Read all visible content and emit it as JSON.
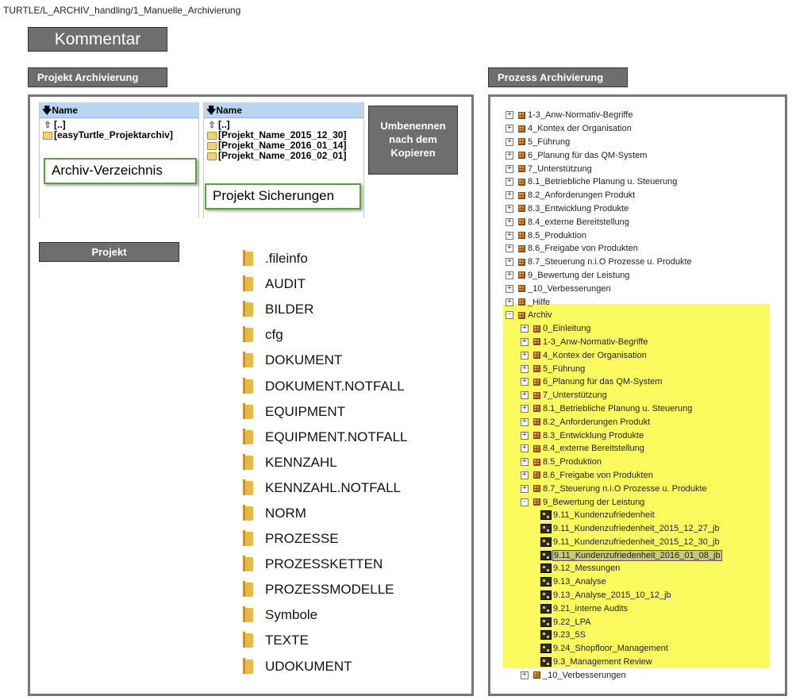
{
  "breadcrumb": "TURTLE/L_ARCHIV_handling/1_Manuelle_Archivierung",
  "kommentar_label": "Kommentar",
  "left_header": "Projekt Archivierung",
  "right_header": "Prozess Archivierung",
  "panel_archive": {
    "column": "Name",
    "rows": [
      "[..]",
      "[easyTurtle_Projektarchiv]"
    ]
  },
  "panel_backups": {
    "column": "Name",
    "rows": [
      "[..]",
      "[Projekt_Name_2015_12_30]",
      "[Projekt_Name_2016_01_14]",
      "[Projekt_Name_2016_02_01]"
    ]
  },
  "callout_archive": "Archiv-Verzeichnis",
  "callout_backups": "Projekt Sicherungen",
  "rename_note": "Umbenennen nach dem Kopieren",
  "projekt_label": "Projekt",
  "project_folders": [
    ".fileinfo",
    "AUDIT",
    "BILDER",
    "cfg",
    "DOKUMENT",
    "DOKUMENT.NOTFALL",
    "EQUIPMENT",
    "EQUIPMENT.NOTFALL",
    "KENNZAHL",
    "KENNZAHL.NOTFALL",
    "NORM",
    "PROZESSE",
    "PROZESSKETTEN",
    "PROZESSMODELLE",
    "Symbole",
    "TEXTE",
    "UDOKUMENT"
  ],
  "colors": {
    "header_bg": "#6e6e6e",
    "callout_border": "#5aa33a",
    "highlight": "#fbfb60",
    "column_header": "#b9d6f0"
  },
  "tree": [
    {
      "level": 0,
      "type": "group",
      "expander": "+",
      "label": "1-3_Anw-Normativ-Begriffe"
    },
    {
      "level": 0,
      "type": "group",
      "expander": "+",
      "label": "4_Kontex der Organisation"
    },
    {
      "level": 0,
      "type": "group",
      "expander": "+",
      "label": "5_Führung"
    },
    {
      "level": 0,
      "type": "group",
      "expander": "+",
      "label": "6_Planung für das QM-System"
    },
    {
      "level": 0,
      "type": "group",
      "expander": "+",
      "label": "7_Unterstützung"
    },
    {
      "level": 0,
      "type": "group",
      "expander": "+",
      "label": "8.1_Betriebliche Planung u. Steuerung"
    },
    {
      "level": 0,
      "type": "group",
      "expander": "+",
      "label": "8.2_Anforderungen Produkt"
    },
    {
      "level": 0,
      "type": "group",
      "expander": "+",
      "label": "8.3_Entwicklung Produkte"
    },
    {
      "level": 0,
      "type": "group",
      "expander": "+",
      "label": "8.4_externe Bereitstellung"
    },
    {
      "level": 0,
      "type": "group",
      "expander": "+",
      "label": "8.5_Produktion"
    },
    {
      "level": 0,
      "type": "group",
      "expander": "+",
      "label": "8.6_Freigabe von Produkten"
    },
    {
      "level": 0,
      "type": "group",
      "expander": "+",
      "label": "8.7_Steuerung n.i.O Prozesse u. Produkte"
    },
    {
      "level": 0,
      "type": "group",
      "expander": "+",
      "label": "9_Bewertung der Leistung"
    },
    {
      "level": 0,
      "type": "group",
      "expander": "+",
      "label": "_10_Verbesserungen"
    },
    {
      "level": 0,
      "type": "group",
      "expander": "+",
      "label": "_Hilfe"
    },
    {
      "level": 0,
      "type": "group",
      "expander": "-",
      "label": "Archiv"
    },
    {
      "level": 1,
      "type": "group",
      "expander": "+",
      "label": "0_Einleitung"
    },
    {
      "level": 1,
      "type": "group",
      "expander": "+",
      "label": "1-3_Anw-Normativ-Begriffe"
    },
    {
      "level": 1,
      "type": "group",
      "expander": "+",
      "label": "4_Kontex der Organisation"
    },
    {
      "level": 1,
      "type": "group",
      "expander": "+",
      "label": "5_Führung"
    },
    {
      "level": 1,
      "type": "group",
      "expander": "+",
      "label": "6_Planung für das QM-System"
    },
    {
      "level": 1,
      "type": "group",
      "expander": "+",
      "label": "7_Unterstützung"
    },
    {
      "level": 1,
      "type": "group",
      "expander": "+",
      "label": "8.1_Betriebliche Planung u. Steuerung"
    },
    {
      "level": 1,
      "type": "group",
      "expander": "+",
      "label": "8.2_Anforderungen Produkt"
    },
    {
      "level": 1,
      "type": "group",
      "expander": "+",
      "label": "8.3_Entwicklung Produkte"
    },
    {
      "level": 1,
      "type": "group",
      "expander": "+",
      "label": "8.4_externe Bereitstellung"
    },
    {
      "level": 1,
      "type": "group",
      "expander": "+",
      "label": "8.5_Produktion"
    },
    {
      "level": 1,
      "type": "group",
      "expander": "+",
      "label": "8.6_Freigabe von Produkten"
    },
    {
      "level": 1,
      "type": "group",
      "expander": "+",
      "label": "8.7_Steuerung n.i.O Prozesse u. Produkte"
    },
    {
      "level": 1,
      "type": "group",
      "expander": "-",
      "label": "9_Bewertung der Leistung"
    },
    {
      "level": 2,
      "type": "process",
      "label": "9.11_Kundenzufriedenheit"
    },
    {
      "level": 2,
      "type": "process",
      "label": "9.11_Kundenzufriedenheit_2015_12_27_jb"
    },
    {
      "level": 2,
      "type": "process",
      "label": "9.11_Kundenzufriedenheit_2015_12_30_jb"
    },
    {
      "level": 2,
      "type": "process",
      "label": "9.11_Kundenzufriedenheit_2016_01_08_jb",
      "selected": true
    },
    {
      "level": 2,
      "type": "process",
      "label": "9.12_Messungen"
    },
    {
      "level": 2,
      "type": "process",
      "label": "9.13_Analyse"
    },
    {
      "level": 2,
      "type": "process",
      "label": "9.13_Analyse_2015_10_12_jb"
    },
    {
      "level": 2,
      "type": "process",
      "label": "9.21_interne Audits"
    },
    {
      "level": 2,
      "type": "process",
      "label": "9.22_LPA"
    },
    {
      "level": 2,
      "type": "process",
      "label": "9.23_5S"
    },
    {
      "level": 2,
      "type": "process",
      "label": "9.24_Shopfloor_Management"
    },
    {
      "level": 2,
      "type": "process",
      "label": "9.3_Management Review"
    },
    {
      "level": 1,
      "type": "group",
      "expander": "+",
      "label": "_10_Verbesserungen"
    }
  ]
}
